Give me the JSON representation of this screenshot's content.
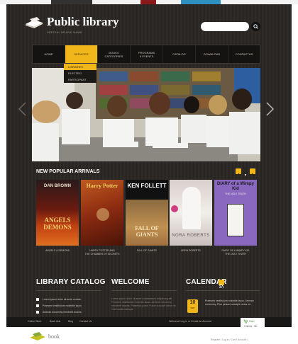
{
  "header": {
    "title": "Public library",
    "tagline": "SPECIAL BRAND NAME",
    "search_placeholder": ""
  },
  "nav": {
    "items": [
      {
        "label": "HOME"
      },
      {
        "label": "SERVICES"
      },
      {
        "label": "BOOKS\nCATEGORIES"
      },
      {
        "label": "PROGRAMS\n& EVENTS"
      },
      {
        "label": "CATALOG"
      },
      {
        "label": "DOWNLOAD"
      },
      {
        "label": "CONTACTUS"
      }
    ],
    "active_index": 1
  },
  "dropdown": {
    "items": [
      "LIBRARIES",
      "ELECTRO",
      "PARTICIPANT"
    ],
    "active_index": 0
  },
  "arrivals": {
    "title": "NEW POPULAR ARRIVALS",
    "books": [
      {
        "cover_author": "DAN BROWN",
        "cover_title": "ANGELS DEMONS",
        "caption": "ANGELS & DEMONS"
      },
      {
        "cover_author": "",
        "cover_title": "Harry Potter",
        "caption": "HARRY POTTER AND\nTHE CHAMBER OF SECRETS"
      },
      {
        "cover_author": "KEN FOLLETT",
        "cover_title": "FALL OF GIANTS",
        "caption": "FALL OF GIANTS"
      },
      {
        "cover_author": "NORA ROBERTS",
        "cover_title": "",
        "caption": "NORA ROBERTS"
      },
      {
        "cover_author": "",
        "cover_title": "DIARY of a Wimpy Kid",
        "cover_subtitle": "THE UGLY TRUTH",
        "caption": "DIARY OF A WIMPY KID\nTHE UGLY TRUTH"
      }
    ]
  },
  "catalog": {
    "title": "LIBRARY CATALOG",
    "items": [
      "Lorem ipsum dolor sit amet consec",
      "Praesent vestibulum molestie lacus",
      "Aenean nonummy hendrerit mauris"
    ]
  },
  "welcome": {
    "title": "WELCOME",
    "text": "Lorem ipsum dolor sit amet consectetuer adipiscing elit. Praesent vestibulum molestie lacus. Aenean nonummy hendrerit mauris. Phasellus porta. Fusce suscipit varius mi. Cum sociis natoque"
  },
  "calendar": {
    "title": "CALENDAR",
    "day": "10",
    "month": "SEP",
    "text": "Praesent vestibulum molestie lacus. Aenean nonummy. Plus pelsare suscipit varius mi."
  },
  "bottom_bar": {
    "links": [
      "Online Store",
      "Book club",
      "Blog",
      "Contact Us"
    ],
    "welcome_text": "Welcome! Log in or Create an Account"
  },
  "cart": {
    "title": "Cart",
    "subtitle": "0 items - $0"
  },
  "footer": {
    "logo_text": "book",
    "links": "Register  /  Log in  /  Cart  /  Account  /"
  },
  "colors": {
    "accent": "#f1b71a",
    "background": "#2a2724",
    "nav_bg": "#151311"
  }
}
